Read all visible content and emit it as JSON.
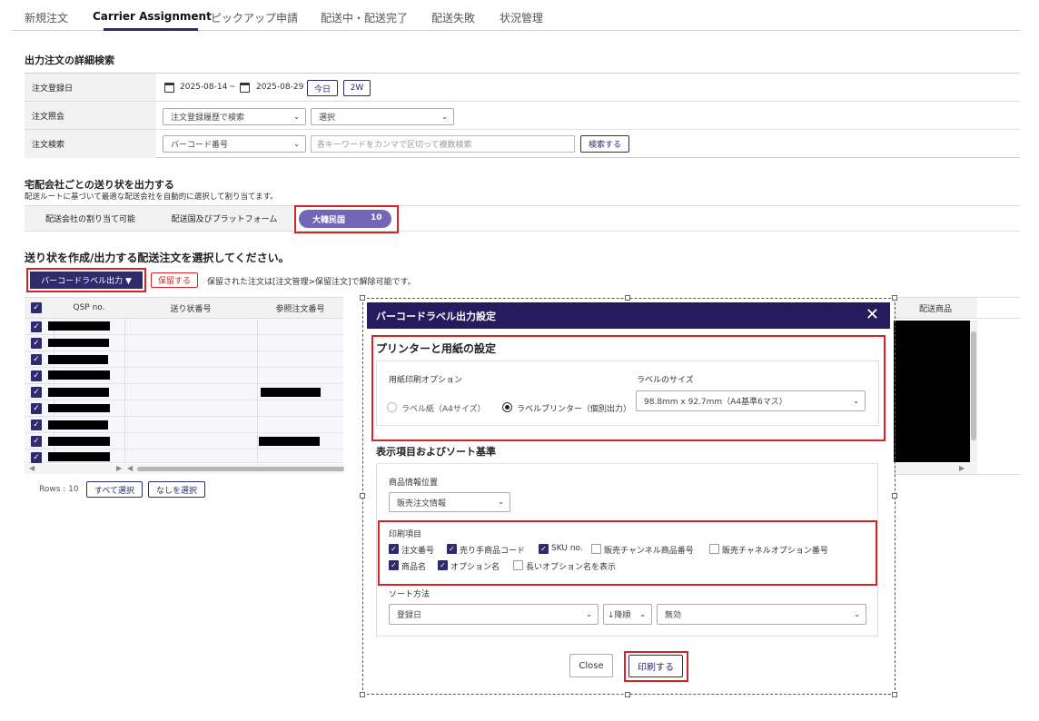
{
  "tabs": [
    "新規注文",
    "Carrier Assignment",
    "ピックアップ申請",
    "配送中・配送完了",
    "配送失敗",
    "状況管理"
  ],
  "search": {
    "title": "出力注文の詳細検索",
    "row1_label": "注文登録日",
    "date_from": "2025-08-14",
    "date_sep": "~",
    "date_to": "2025-08-29",
    "today_btn": "今日",
    "two_week_btn": "2W",
    "row2_label": "注文照会",
    "row2_select1": "注文登録履歴で検索",
    "row2_select2": "選択",
    "row3_label": "注文検索",
    "row3_select": "バーコード番号",
    "keyword_placeholder": "各キーワードをカンマで区切って複数検索",
    "search_btn": "検索する"
  },
  "carrier": {
    "title": "宅配会社ごとの送り状を出力する",
    "desc": "配送ルートに基づいて最適な配送会社を自動的に選択して割り当てます。",
    "col1": "配送会社の割り当て可能",
    "col2": "配送国及びプラットフォーム",
    "country": "大韓民国",
    "count": "10"
  },
  "orders": {
    "title": "送り状を作成/出力する配送注文を選択してください。",
    "barcode_btn": "バーコードラベル出力 ▼",
    "hold_btn": "保留する",
    "hold_note": "保留された注文は[注文管理>保留注文]で解除可能です。",
    "headers": [
      "QSP no.",
      "送り状番号",
      "参照注文番号"
    ],
    "right_header": "配送商品",
    "rows_label": "Rows : 10",
    "select_all": "すべて選択",
    "select_none": "なしを選択"
  },
  "modal": {
    "title": "バーコードラベル出力設定",
    "close_x": "✕",
    "printer_section": "プリンターと用紙の設定",
    "paper_option_label": "用紙印刷オプション",
    "label_size_label": "ラベルのサイズ",
    "radio_a4": "ラベル紙（A4サイズ）",
    "radio_printer": "ラベルプリンター（個別出力）",
    "label_size_value": "98.8mm x 92.7mm（A4基準6マス）",
    "display_section": "表示項目およびソート基準",
    "product_info_label": "商品情報位置",
    "product_info_value": "販売注文情報",
    "print_items_label": "印刷項目",
    "items_row1": [
      {
        "label": "注文番号",
        "checked": true
      },
      {
        "label": "売り手商品コード",
        "checked": true
      },
      {
        "label": "SKU no.",
        "checked": true
      },
      {
        "label": "販売チャンネル商品番号",
        "checked": false
      },
      {
        "label": "販売チャネルオプション番号",
        "checked": false
      }
    ],
    "items_row2": [
      {
        "label": "商品名",
        "checked": true
      },
      {
        "label": "オプション名",
        "checked": true
      },
      {
        "label": "長いオプション名を表示",
        "checked": false
      }
    ],
    "sort_label": "ソート方法",
    "sort_field": "登録日",
    "sort_order": "↓降順",
    "sort_extra": "無効",
    "close_btn": "Close",
    "print_btn": "印刷する"
  },
  "colors": {
    "navy": "#2d2a6e",
    "modal_header": "#261b5e",
    "pill": "#7466b6",
    "highlight_red": "#d62323"
  }
}
